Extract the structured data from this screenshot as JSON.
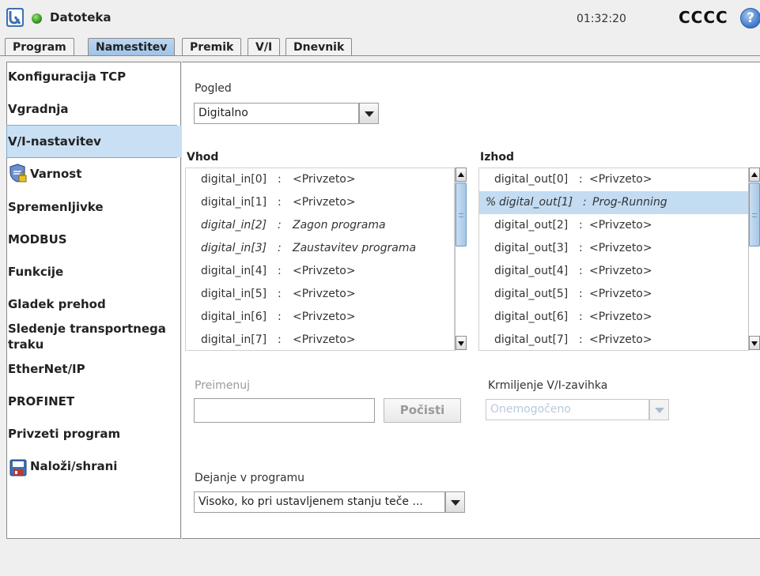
{
  "header": {
    "app_title": "Datoteka",
    "clock": "01:32:20",
    "robot_name": "CCCC",
    "help_icon": "?"
  },
  "tabs": [
    {
      "label": "Program"
    },
    {
      "label": "Namestitev"
    },
    {
      "label": "Premik"
    },
    {
      "label": "V/I"
    },
    {
      "label": "Dnevnik"
    }
  ],
  "sidebar": {
    "items": [
      {
        "label": "Konfiguracija TCP"
      },
      {
        "label": "Vgradnja"
      },
      {
        "label": "V/I-nastavitev"
      },
      {
        "label": "Varnost"
      },
      {
        "label": "Spremenljivke"
      },
      {
        "label": "MODBUS"
      },
      {
        "label": "Funkcije"
      },
      {
        "label": "Gladek prehod"
      },
      {
        "label": "Sledenje transportnega traku"
      },
      {
        "label": "EtherNet/IP"
      },
      {
        "label": "PROFINET"
      },
      {
        "label": "Privzeti program"
      },
      {
        "label": "Naloži/shrani"
      }
    ]
  },
  "view": {
    "label": "Pogled",
    "selected": "Digitalno"
  },
  "inputs": {
    "header": "Vhod",
    "rows": [
      {
        "name": "digital_in[0]",
        "sep": ":",
        "value": "<Privzeto>",
        "italic": false
      },
      {
        "name": "digital_in[1]",
        "sep": ":",
        "value": "<Privzeto>",
        "italic": false
      },
      {
        "name": "digital_in[2]",
        "sep": ":",
        "value": "Zagon programa",
        "italic": true
      },
      {
        "name": "digital_in[3]",
        "sep": ":",
        "value": "Zaustavitev programa",
        "italic": true
      },
      {
        "name": "digital_in[4]",
        "sep": ":",
        "value": "<Privzeto>",
        "italic": false
      },
      {
        "name": "digital_in[5]",
        "sep": ":",
        "value": "<Privzeto>",
        "italic": false
      },
      {
        "name": "digital_in[6]",
        "sep": ":",
        "value": "<Privzeto>",
        "italic": false
      },
      {
        "name": "digital_in[7]",
        "sep": ":",
        "value": "<Privzeto>",
        "italic": false
      }
    ]
  },
  "outputs": {
    "header": "Izhod",
    "rows": [
      {
        "prefix": "",
        "name": "digital_out[0]",
        "sep": ":",
        "value": "<Privzeto>",
        "italic": false,
        "selected": false
      },
      {
        "prefix": "%",
        "name": "digital_out[1]",
        "sep": ":",
        "value": "Prog-Running",
        "italic": true,
        "selected": true
      },
      {
        "prefix": "",
        "name": "digital_out[2]",
        "sep": ":",
        "value": "<Privzeto>",
        "italic": false,
        "selected": false
      },
      {
        "prefix": "",
        "name": "digital_out[3]",
        "sep": ":",
        "value": "<Privzeto>",
        "italic": false,
        "selected": false
      },
      {
        "prefix": "",
        "name": "digital_out[4]",
        "sep": ":",
        "value": "<Privzeto>",
        "italic": false,
        "selected": false
      },
      {
        "prefix": "",
        "name": "digital_out[5]",
        "sep": ":",
        "value": "<Privzeto>",
        "italic": false,
        "selected": false
      },
      {
        "prefix": "",
        "name": "digital_out[6]",
        "sep": ":",
        "value": "<Privzeto>",
        "italic": false,
        "selected": false
      },
      {
        "prefix": "",
        "name": "digital_out[7]",
        "sep": ":",
        "value": "<Privzeto>",
        "italic": false,
        "selected": false
      }
    ]
  },
  "rename": {
    "label": "Preimenuj",
    "value": "",
    "clear_button": "Počisti"
  },
  "io_tab_control": {
    "label": "Krmiljenje V/I-zavihka",
    "selected": "Onemogočeno"
  },
  "program_action": {
    "label": "Dejanje v programu",
    "selected": "Visoko, ko pri ustavljenem stanju teče ..."
  },
  "colors": {
    "selection": "#c3dcf2",
    "active_tab": "#9fc2e6",
    "status_ok": "#3a9a23"
  },
  "icons": {
    "logo": "ur-logo-icon",
    "status": "status-ok-icon",
    "help": "help-icon",
    "security": "shield-lock-icon",
    "save": "floppy-disk-icon"
  }
}
